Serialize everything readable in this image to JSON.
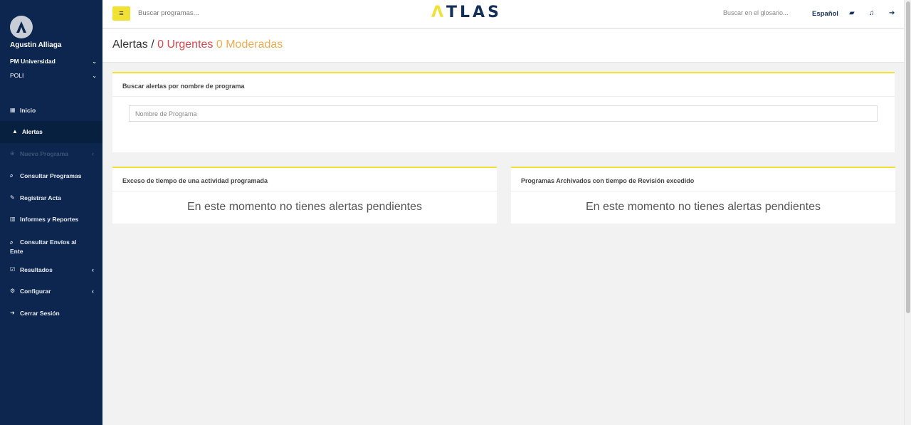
{
  "sidebar": {
    "user_name": "Agustin Alliaga",
    "university": "PM Universidad",
    "institution": "POLI",
    "items": [
      {
        "label": "Inicio",
        "icon": "dashboard-icon",
        "glyph": "▦"
      },
      {
        "label": "Alertas",
        "icon": "bell-icon",
        "glyph": "🔔",
        "active": true
      },
      {
        "label": "Nuevo Programa",
        "icon": "plus-circle-icon",
        "glyph": "⊕",
        "disabled": true
      },
      {
        "label": "Consultar Programas",
        "icon": "search-icon",
        "glyph": "⌕"
      },
      {
        "label": "Registrar Acta",
        "icon": "pencil-icon",
        "glyph": "✎"
      },
      {
        "label": "Informes y Reportes",
        "icon": "bar-chart-icon",
        "glyph": "▥"
      },
      {
        "label": "Consultar Envíos al Ente",
        "icon": "search-icon",
        "glyph": "⌕"
      },
      {
        "label": "Resultados",
        "icon": "check-square-icon",
        "glyph": "☑"
      },
      {
        "label": "Configurar",
        "icon": "cogs-icon",
        "glyph": "⚙"
      },
      {
        "label": "Cerrar Sesión",
        "icon": "sign-out-icon",
        "glyph": "➜"
      }
    ]
  },
  "topbar": {
    "search_placeholder": "Buscar programas...",
    "logo": "TLAS",
    "logo_first": "Λ",
    "glossary_placeholder": "Buscar en el glosario...",
    "language": "Español"
  },
  "header": {
    "title": "Alertas",
    "separator": "/",
    "urgent": "0 Urgentes",
    "moderate": "0 Moderadas"
  },
  "search_panel": {
    "title": "Buscar alertas por nombre de programa",
    "placeholder": "Nombre de Programa"
  },
  "panels": [
    {
      "title": "Exceso de tiempo de una actividad programada",
      "message": "En este momento no tienes alertas pendientes"
    },
    {
      "title": "Programas Archivados con tiempo de Revisión excedido",
      "message": "En este momento no tienes alertas pendientes"
    }
  ],
  "colors": {
    "sidebar_bg": "#0c2650",
    "accent_yellow": "#f1e135",
    "urgent_red": "#e0454a",
    "moderate_orange": "#f0ad4e"
  }
}
